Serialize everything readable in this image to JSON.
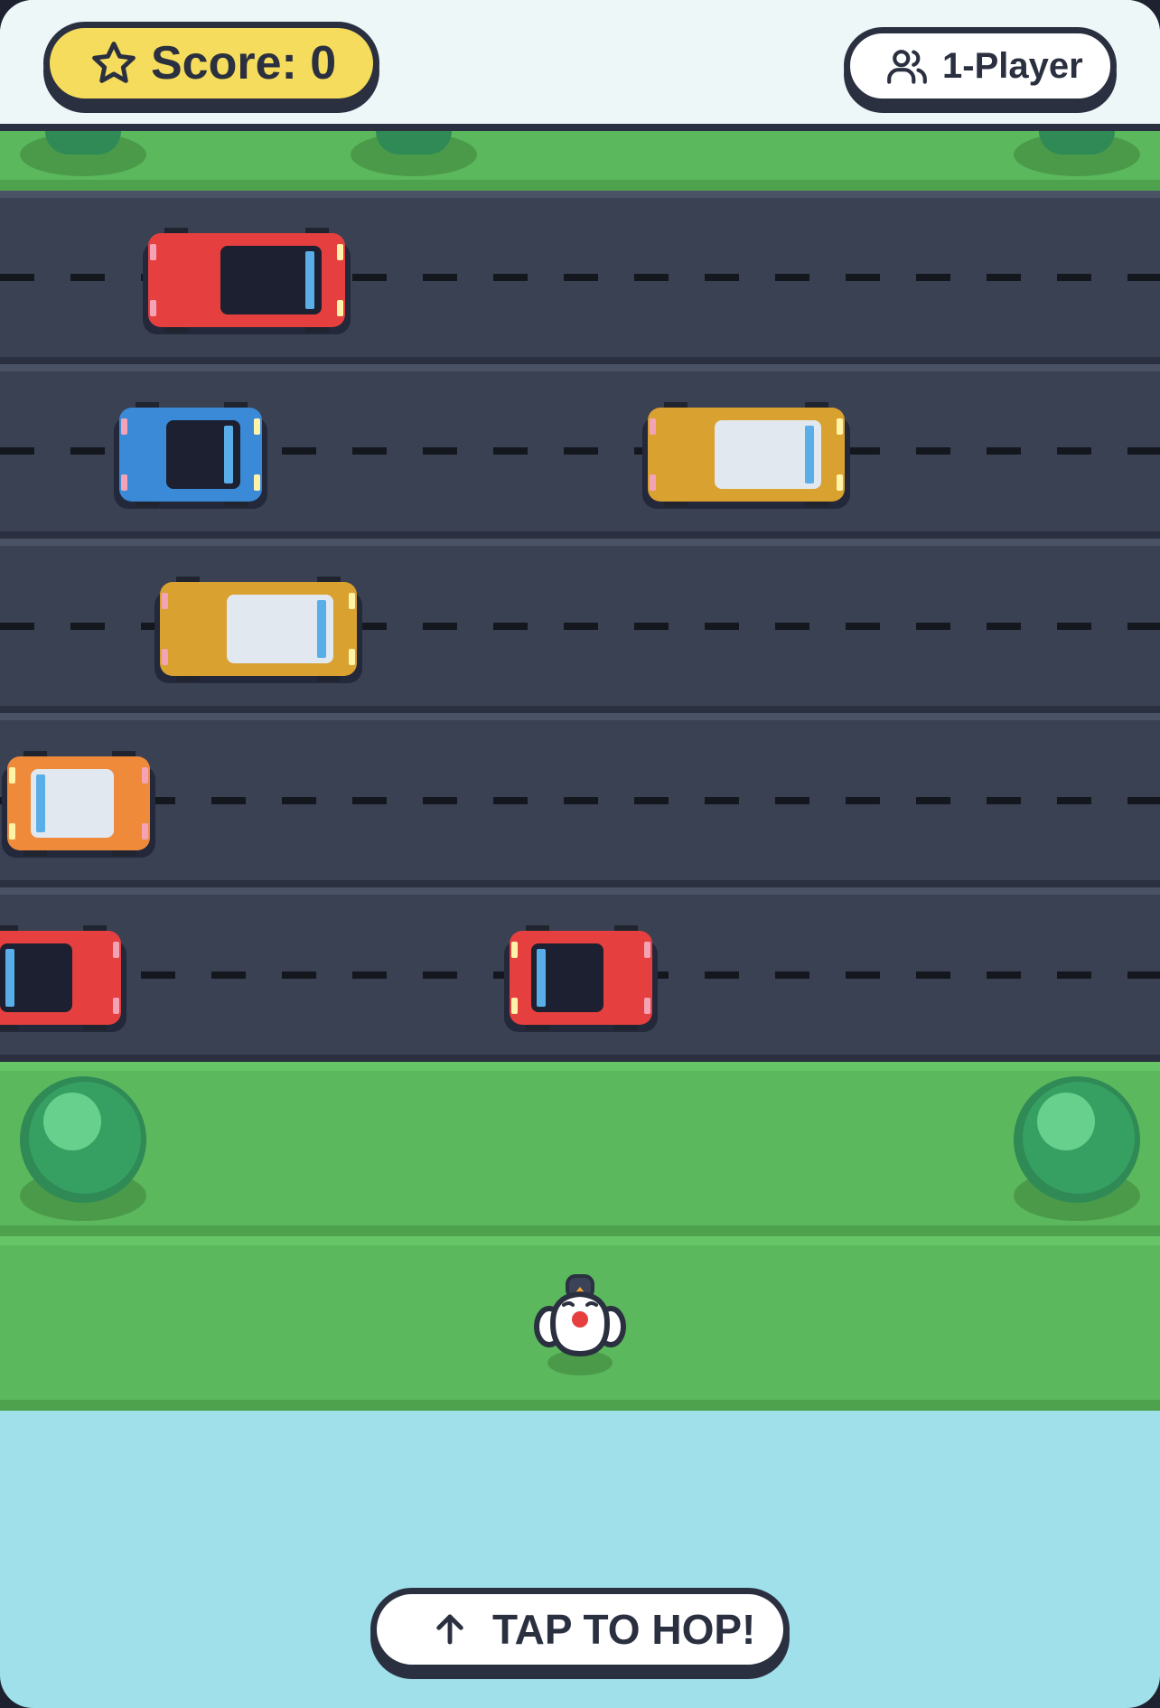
{
  "header": {
    "score_label": "Score: 0",
    "mode_label": "1-Player",
    "score_icon": "star-icon",
    "mode_icon": "users-icon"
  },
  "game": {
    "lane_count": 5,
    "lanes": [
      {
        "lane": 1,
        "vehicles": [
          {
            "type": "car",
            "color": "red",
            "direction": "right"
          }
        ]
      },
      {
        "lane": 2,
        "vehicles": [
          {
            "type": "car",
            "color": "blue",
            "direction": "right"
          },
          {
            "type": "van",
            "color": "mustard",
            "direction": "right"
          }
        ]
      },
      {
        "lane": 3,
        "vehicles": [
          {
            "type": "van",
            "color": "mustard",
            "direction": "right"
          }
        ]
      },
      {
        "lane": 4,
        "vehicles": [
          {
            "type": "van",
            "color": "orange",
            "direction": "left"
          }
        ]
      },
      {
        "lane": 5,
        "vehicles": [
          {
            "type": "car",
            "color": "red",
            "direction": "left"
          },
          {
            "type": "car",
            "color": "red",
            "direction": "left"
          }
        ]
      }
    ],
    "player": {
      "character": "chicken",
      "name": "chicken-player"
    }
  },
  "controls": {
    "hop_label": "TAP TO HOP!",
    "hop_icon": "arrow-up-icon"
  },
  "colors": {
    "grass": "#5cb85c",
    "road": "#394152",
    "water": "#a0e0ea",
    "score_pill": "#f5dc5c",
    "outline": "#2b3040"
  }
}
